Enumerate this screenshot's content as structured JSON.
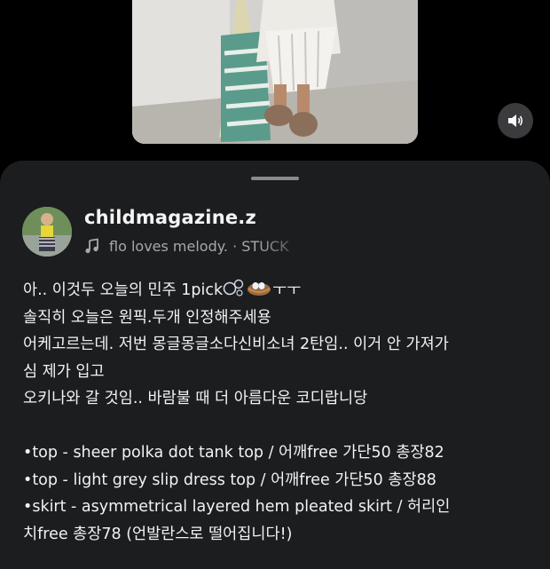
{
  "post": {
    "username": "childmagazine.z",
    "audio_icon": "music-note-icon",
    "audio_text": "flo loves melody. · STUCK"
  },
  "controls": {
    "sound_icon": "speaker-icon"
  },
  "caption": {
    "line1_text": "아.. 이것두 오늘의 민주 1pick",
    "line1_tail": "ㅜㅜ",
    "line1_emojis": [
      "bubbles-emoji",
      "nest-emoji"
    ],
    "line2": "솔직히 오늘은 원픽.두개 인정해주세용",
    "line3": "어케고르는데. 저번 몽글몽글소다신비소녀 2탄임.. 이거 안 가져가",
    "line4": "심 제가 입고",
    "line5": "오키나와 갈 것임.. 바람불 때 더 아름다운 코디랍니당",
    "item1": "•top - sheer polka dot tank top / 어깨free 가단50 총장82",
    "item2": "•top - light grey slip dress top / 어깨free 가단50 총장88",
    "item3": "•skirt - asymmetrical layered hem  pleated skirt / 허리인",
    "item3_cont": "치free 총장78 (언발란스로 떨어집니다!)"
  }
}
